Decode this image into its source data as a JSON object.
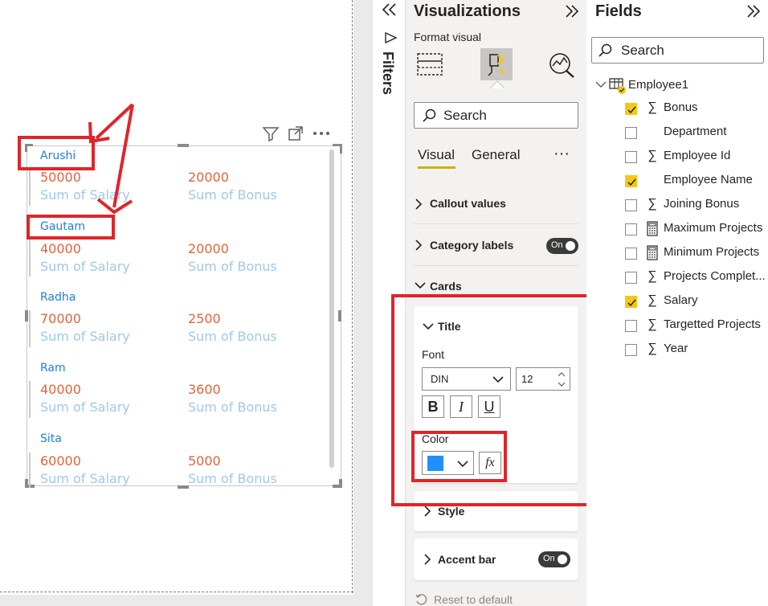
{
  "cards": [
    {
      "title": "Arushi",
      "salary": "50000",
      "salary_label": "Sum of Salary",
      "bonus": "20000",
      "bonus_label": "Sum of Bonus"
    },
    {
      "title": "Gautam",
      "salary": "40000",
      "salary_label": "Sum of Salary",
      "bonus": "20000",
      "bonus_label": "Sum of Bonus"
    },
    {
      "title": "Radha",
      "salary": "70000",
      "salary_label": "Sum of Salary",
      "bonus": "2500",
      "bonus_label": "Sum of Bonus"
    },
    {
      "title": "Ram",
      "salary": "40000",
      "salary_label": "Sum of Salary",
      "bonus": "3600",
      "bonus_label": "Sum of Bonus"
    },
    {
      "title": "Sita",
      "salary": "60000",
      "salary_label": "Sum of Salary",
      "bonus": "5000",
      "bonus_label": "Sum of Bonus"
    }
  ],
  "filters": {
    "label": "Filters"
  },
  "viz": {
    "title": "Visualizations",
    "subtitle": "Format visual",
    "search_placeholder": "Search",
    "tab_visual": "Visual",
    "tab_general": "General",
    "more": "···",
    "sections": {
      "callout": "Callout values",
      "category": "Category labels",
      "cards": "Cards",
      "title": "Title",
      "style": "Style",
      "accent": "Accent bar"
    },
    "toggle_on": "On",
    "font_label": "Font",
    "font_family": "DIN",
    "font_size": "12",
    "bold": "B",
    "italic": "I",
    "underline": "U",
    "color_label": "Color",
    "color_value": "#1e90ff",
    "fx": "fx",
    "reset": "Reset to default"
  },
  "fields": {
    "title": "Fields",
    "search_placeholder": "Search",
    "table": "Employee1",
    "items": [
      {
        "name": "Bonus",
        "checked": true,
        "icon": "sigma-icon"
      },
      {
        "name": "Department",
        "checked": false,
        "icon": "none"
      },
      {
        "name": "Employee Id",
        "checked": false,
        "icon": "sigma-icon"
      },
      {
        "name": "Employee Name",
        "checked": true,
        "icon": "none"
      },
      {
        "name": "Joining Bonus",
        "checked": false,
        "icon": "sigma-icon"
      },
      {
        "name": "Maximum Projects",
        "checked": false,
        "icon": "calculator-icon"
      },
      {
        "name": "Minimum Projects",
        "checked": false,
        "icon": "calculator-icon"
      },
      {
        "name": "Projects Complet...",
        "checked": false,
        "icon": "sigma-icon"
      },
      {
        "name": "Salary",
        "checked": true,
        "icon": "sigma-icon"
      },
      {
        "name": "Targetted Projects",
        "checked": false,
        "icon": "sigma-icon"
      },
      {
        "name": "Year",
        "checked": false,
        "icon": "sigma-icon"
      }
    ]
  }
}
